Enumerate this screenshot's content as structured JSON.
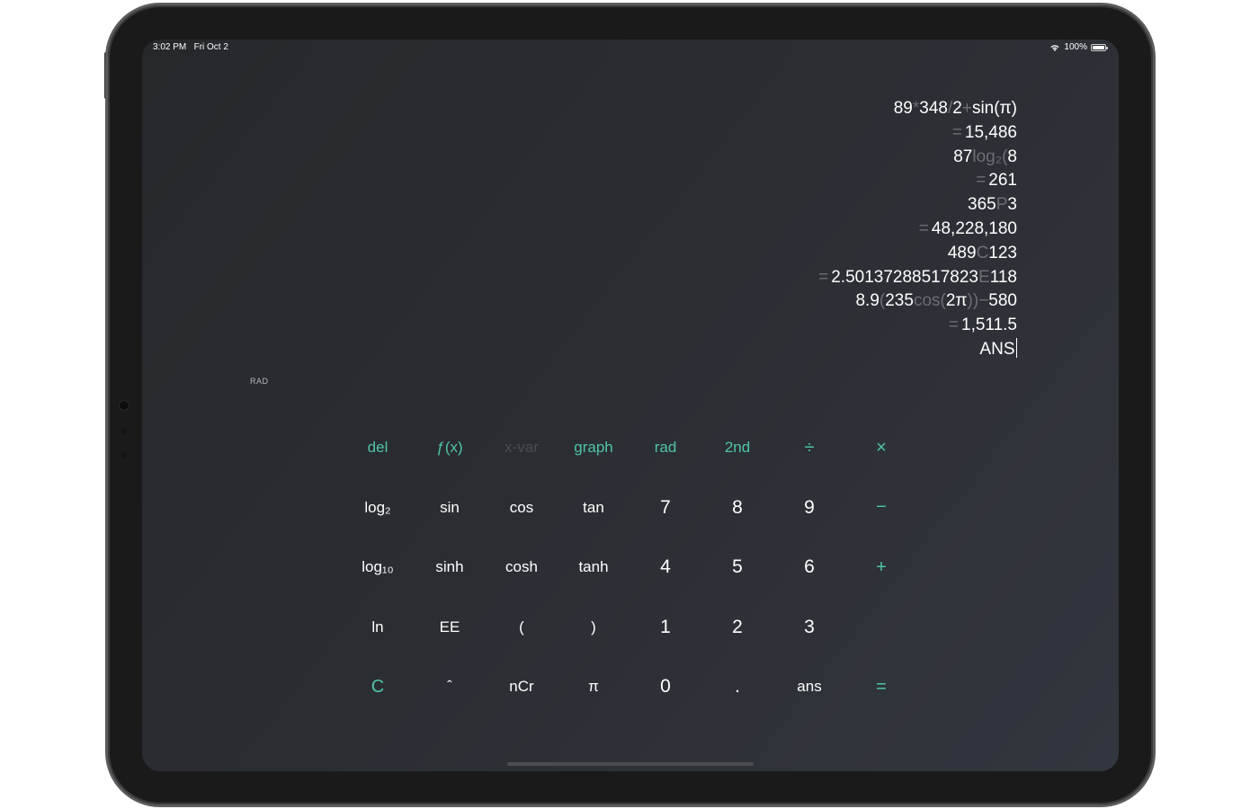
{
  "status_bar": {
    "time": "3:02 PM",
    "date": "Fri Oct 2",
    "battery": "100%"
  },
  "history": [
    {
      "type": "expr",
      "parts": [
        [
          "num",
          "89"
        ],
        [
          "op",
          "*"
        ],
        [
          "num",
          "348"
        ],
        [
          "op",
          "/"
        ],
        [
          "num",
          "2"
        ],
        [
          "op",
          "+"
        ],
        [
          "num",
          "sin(π)"
        ]
      ]
    },
    {
      "type": "result",
      "eq": "=",
      "value": "15,486"
    },
    {
      "type": "expr",
      "parts": [
        [
          "num",
          "87"
        ],
        [
          "op",
          "log₂("
        ],
        [
          "num",
          "8"
        ]
      ]
    },
    {
      "type": "result",
      "eq": "=",
      "value": "261"
    },
    {
      "type": "expr",
      "parts": [
        [
          "num",
          "365"
        ],
        [
          "op",
          "P"
        ],
        [
          "num",
          "3"
        ]
      ]
    },
    {
      "type": "result",
      "eq": "=",
      "value": "48,228,180"
    },
    {
      "type": "expr",
      "parts": [
        [
          "num",
          "489"
        ],
        [
          "op",
          "C"
        ],
        [
          "num",
          "123"
        ]
      ]
    },
    {
      "type": "result_e",
      "eq": "=",
      "mantissa": "2.50137288517823",
      "e": "E",
      "exp": "118"
    },
    {
      "type": "expr",
      "parts": [
        [
          "num",
          "8.9"
        ],
        [
          "op",
          "("
        ],
        [
          "num",
          "235"
        ],
        [
          "op",
          "cos("
        ],
        [
          "num",
          "2π"
        ],
        [
          "op",
          "))"
        ],
        [
          "op",
          "−"
        ],
        [
          "num",
          "580"
        ]
      ]
    },
    {
      "type": "result",
      "eq": "=",
      "value": "1,511.5"
    },
    {
      "type": "current",
      "value": "ANS"
    }
  ],
  "mode_indicator": "RAD",
  "keypad": {
    "rows": [
      [
        {
          "label": "del",
          "name": "del-key",
          "style": "accent"
        },
        {
          "label": "ƒ(x)",
          "name": "fx-key",
          "style": "accent"
        },
        {
          "label": "x-var",
          "name": "x-var-key",
          "style": "disabled"
        },
        {
          "label": "graph",
          "name": "graph-key",
          "style": "accent"
        },
        {
          "label": "rad",
          "name": "rad-key",
          "style": "accent"
        },
        {
          "label": "2nd",
          "name": "second-key",
          "style": "accent"
        },
        {
          "label": "÷",
          "name": "divide-key",
          "style": "accent big-op"
        },
        {
          "label": "×",
          "name": "multiply-key",
          "style": "accent big-op"
        }
      ],
      [
        {
          "label": "log₂",
          "name": "log2-key",
          "style": "fn"
        },
        {
          "label": "sin",
          "name": "sin-key",
          "style": "fn"
        },
        {
          "label": "cos",
          "name": "cos-key",
          "style": "fn"
        },
        {
          "label": "tan",
          "name": "tan-key",
          "style": "fn"
        },
        {
          "label": "7",
          "name": "digit-7-key",
          "style": "digit"
        },
        {
          "label": "8",
          "name": "digit-8-key",
          "style": "digit"
        },
        {
          "label": "9",
          "name": "digit-9-key",
          "style": "digit"
        },
        {
          "label": "−",
          "name": "minus-key",
          "style": "accent big-op"
        }
      ],
      [
        {
          "label": "log₁₀",
          "name": "log10-key",
          "style": "fn"
        },
        {
          "label": "sinh",
          "name": "sinh-key",
          "style": "fn"
        },
        {
          "label": "cosh",
          "name": "cosh-key",
          "style": "fn"
        },
        {
          "label": "tanh",
          "name": "tanh-key",
          "style": "fn"
        },
        {
          "label": "4",
          "name": "digit-4-key",
          "style": "digit"
        },
        {
          "label": "5",
          "name": "digit-5-key",
          "style": "digit"
        },
        {
          "label": "6",
          "name": "digit-6-key",
          "style": "digit"
        },
        {
          "label": "+",
          "name": "plus-key",
          "style": "accent big-op"
        }
      ],
      [
        {
          "label": "ln",
          "name": "ln-key",
          "style": "fn"
        },
        {
          "label": "EE",
          "name": "ee-key",
          "style": "fn"
        },
        {
          "label": "(",
          "name": "open-paren-key",
          "style": "fn"
        },
        {
          "label": ")",
          "name": "close-paren-key",
          "style": "fn"
        },
        {
          "label": "1",
          "name": "digit-1-key",
          "style": "digit"
        },
        {
          "label": "2",
          "name": "digit-2-key",
          "style": "digit"
        },
        {
          "label": "3",
          "name": "digit-3-key",
          "style": "digit"
        },
        {
          "label": "",
          "name": "empty-key",
          "style": "fn"
        }
      ],
      [
        {
          "label": "C",
          "name": "clear-key",
          "style": "accent big-op"
        },
        {
          "label": "ˆ",
          "name": "power-key",
          "style": "fn"
        },
        {
          "label": "nCr",
          "name": "ncr-key",
          "style": "fn"
        },
        {
          "label": "π",
          "name": "pi-key",
          "style": "fn"
        },
        {
          "label": "0",
          "name": "digit-0-key",
          "style": "digit"
        },
        {
          "label": ".",
          "name": "decimal-key",
          "style": "digit"
        },
        {
          "label": "ans",
          "name": "ans-key",
          "style": "fn"
        },
        {
          "label": "=",
          "name": "equals-key",
          "style": "accent big-op"
        }
      ]
    ]
  },
  "colors": {
    "accent": "#4fc4a7",
    "operator_dim": "#6b6e73",
    "background": "#2a2d32"
  },
  "icons": [
    "wifi-icon",
    "battery-icon"
  ]
}
